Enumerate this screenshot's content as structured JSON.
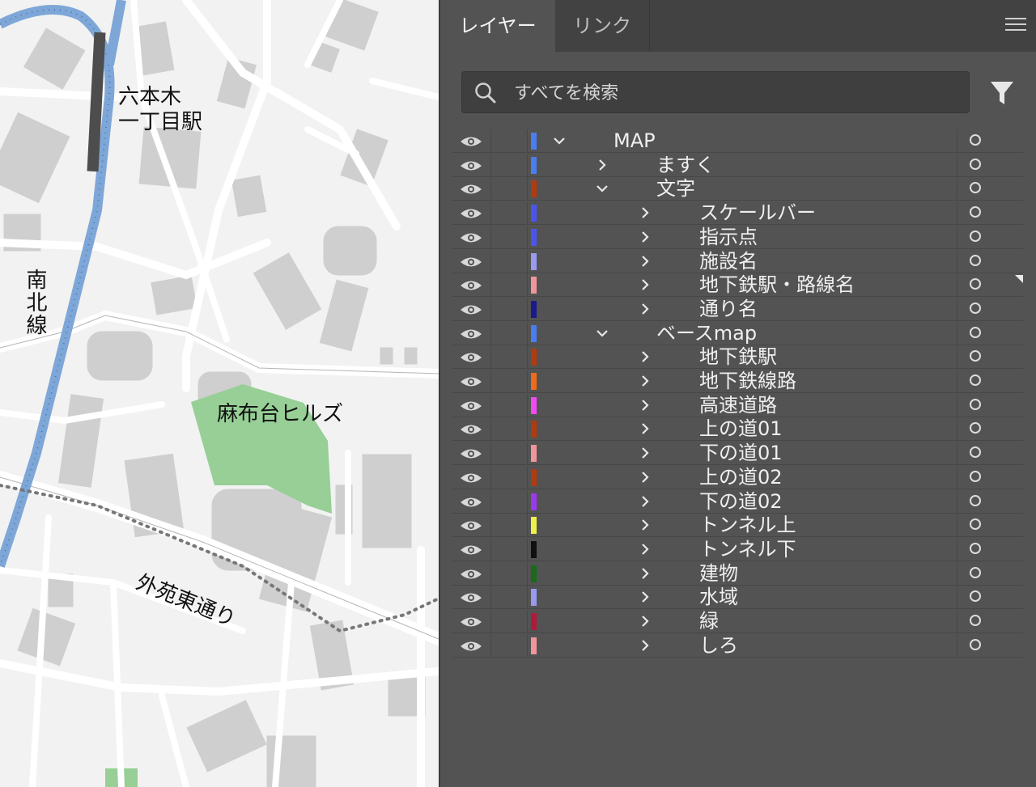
{
  "map": {
    "labels": {
      "station": "六本木\n一丁目駅",
      "line": "南北線",
      "hills": "麻布台ヒルズ",
      "street": "外苑東通り"
    }
  },
  "panel": {
    "tabs": [
      {
        "label": "レイヤー",
        "active": true
      },
      {
        "label": "リンク",
        "active": false
      }
    ],
    "search": {
      "placeholder": "すべてを検索",
      "value": ""
    },
    "layers": [
      {
        "name": "MAP",
        "level": 0,
        "expanded": true,
        "color": "#4a7df0"
      },
      {
        "name": "ますく",
        "level": 1,
        "expanded": false,
        "color": "#4a7df0"
      },
      {
        "name": "文字",
        "level": 1,
        "expanded": true,
        "color": "#b23a0f"
      },
      {
        "name": "スケールバー",
        "level": 2,
        "expanded": false,
        "color": "#4a55f0"
      },
      {
        "name": "指示点",
        "level": 2,
        "expanded": false,
        "color": "#4a55f0"
      },
      {
        "name": "施設名",
        "level": 2,
        "expanded": false,
        "color": "#9a9af0"
      },
      {
        "name": "地下鉄駅・路線名",
        "level": 2,
        "expanded": false,
        "color": "#f0959a"
      },
      {
        "name": "通り名",
        "level": 2,
        "expanded": false,
        "color": "#1a1a8a"
      },
      {
        "name": "ベースmap",
        "level": 1,
        "expanded": true,
        "color": "#4a7df0"
      },
      {
        "name": "地下鉄駅",
        "level": 2,
        "expanded": false,
        "color": "#b23a0f"
      },
      {
        "name": "地下鉄線路",
        "level": 2,
        "expanded": false,
        "color": "#f06a1a"
      },
      {
        "name": "高速道路",
        "level": 2,
        "expanded": false,
        "color": "#f04af0"
      },
      {
        "name": "上の道01",
        "level": 2,
        "expanded": false,
        "color": "#b23a0f"
      },
      {
        "name": "下の道01",
        "level": 2,
        "expanded": false,
        "color": "#f0959a"
      },
      {
        "name": "上の道02",
        "level": 2,
        "expanded": false,
        "color": "#b23a0f"
      },
      {
        "name": "下の道02",
        "level": 2,
        "expanded": false,
        "color": "#9a3af0"
      },
      {
        "name": "トンネル上",
        "level": 2,
        "expanded": false,
        "color": "#f0f04a"
      },
      {
        "name": "トンネル下",
        "level": 2,
        "expanded": false,
        "color": "#101010"
      },
      {
        "name": "建物",
        "level": 2,
        "expanded": false,
        "color": "#1a6a1a"
      },
      {
        "name": "水域",
        "level": 2,
        "expanded": false,
        "color": "#9a9af0"
      },
      {
        "name": "緑",
        "level": 2,
        "expanded": false,
        "color": "#b01a3a"
      },
      {
        "name": "しろ",
        "level": 2,
        "expanded": false,
        "color": "#f0959a"
      }
    ],
    "icons": {
      "search": "search-icon",
      "filter": "filter-icon",
      "menu": "hamburger-menu-icon",
      "visibility": "eye-icon",
      "target": "target-circle-icon"
    }
  }
}
